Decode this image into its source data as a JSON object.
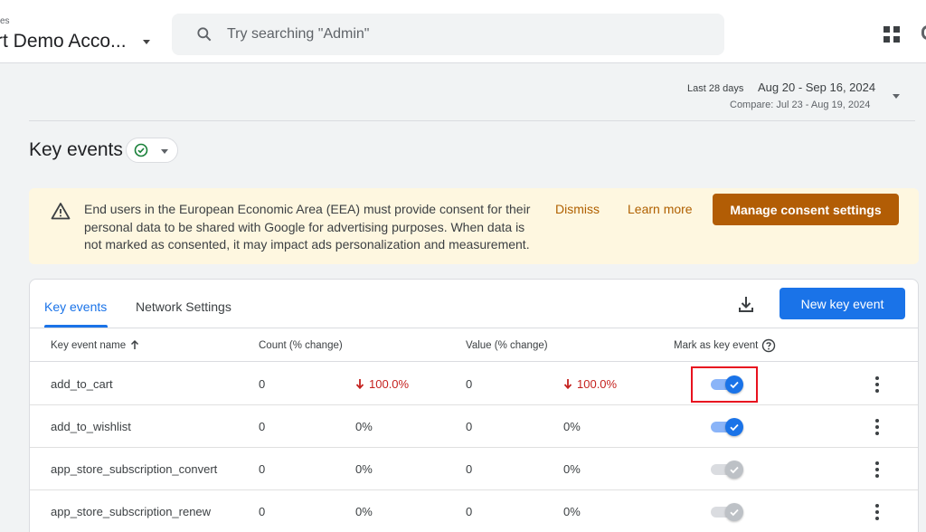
{
  "header": {
    "account_crumb": "es",
    "account_name": "rt Demo Acco...",
    "search_placeholder": "Try searching \"Admin\""
  },
  "date_range": {
    "preset": "Last 28 days",
    "range": "Aug 20 - Sep 16, 2024",
    "compare": "Compare: Jul 23 - Aug 19, 2024"
  },
  "page": {
    "title": "Key events"
  },
  "banner": {
    "text": "End users in the European Economic Area (EEA) must provide consent for their personal data to be shared with Google for advertising purposes. When data is not marked as consented, it may impact ads personalization and measurement.",
    "dismiss": "Dismiss",
    "learn_more": "Learn more",
    "manage": "Manage consent settings"
  },
  "tabs": [
    {
      "label": "Key events",
      "active": true
    },
    {
      "label": "Network Settings",
      "active": false
    }
  ],
  "actions": {
    "new_key_event": "New key event"
  },
  "table": {
    "headers": {
      "name": "Key event name",
      "count": "Count (% change)",
      "value": "Value (% change)",
      "mark": "Mark as key event"
    },
    "rows": [
      {
        "name": "add_to_cart",
        "count": "0",
        "count_change": "100.0%",
        "count_down": true,
        "value": "0",
        "value_change": "100.0%",
        "value_down": true,
        "marked": true
      },
      {
        "name": "add_to_wishlist",
        "count": "0",
        "count_change": "0%",
        "count_down": false,
        "value": "0",
        "value_change": "0%",
        "value_down": false,
        "marked": true
      },
      {
        "name": "app_store_subscription_convert",
        "count": "0",
        "count_change": "0%",
        "count_down": false,
        "value": "0",
        "value_change": "0%",
        "value_down": false,
        "marked": false
      },
      {
        "name": "app_store_subscription_renew",
        "count": "0",
        "count_change": "0%",
        "count_down": false,
        "value": "0",
        "value_change": "0%",
        "value_down": false,
        "marked": false
      }
    ]
  },
  "colors": {
    "primary": "#1a73e8",
    "banner_bg": "#fef7e0",
    "banner_button": "#b25d05",
    "negative": "#c5221f",
    "highlight": "#e8121f"
  },
  "icons": [
    "search-icon",
    "apps-grid-icon",
    "check-circle-icon",
    "warning-icon",
    "download-icon",
    "arrow-up-icon",
    "help-icon",
    "arrow-down-icon",
    "more-vert-icon"
  ]
}
